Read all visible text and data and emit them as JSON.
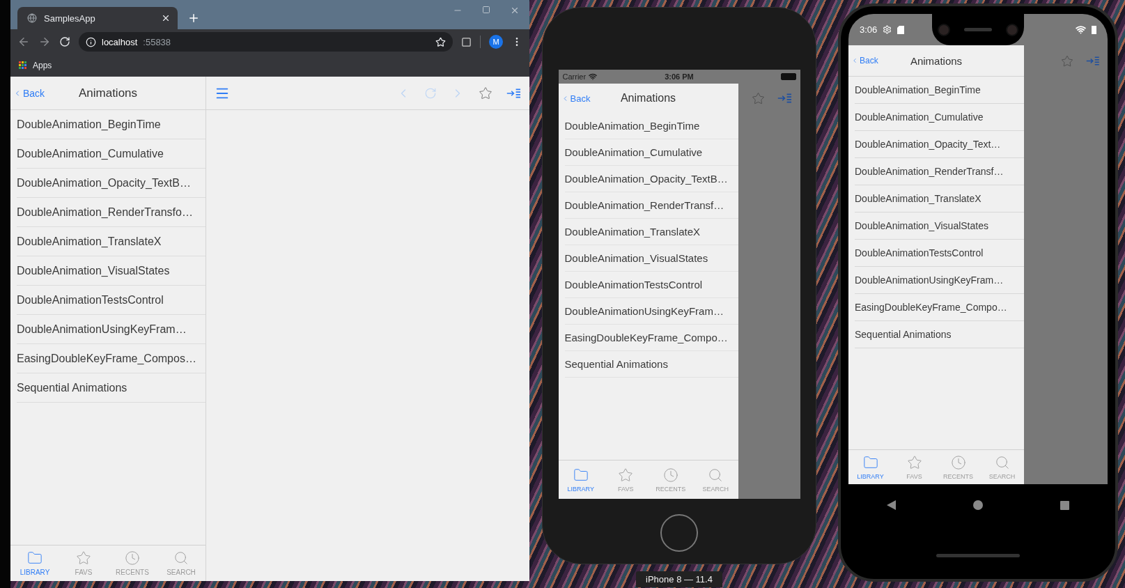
{
  "browser": {
    "tab_title": "SamplesApp",
    "url_host": "localhost",
    "url_port": ":55838",
    "avatar": "M",
    "bookmark": "Apps",
    "app": {
      "back": "Back",
      "title": "Animations",
      "items": [
        "DoubleAnimation_BeginTime",
        "DoubleAnimation_Cumulative",
        "DoubleAnimation_Opacity_TextB…",
        "DoubleAnimation_RenderTransfo…",
        "DoubleAnimation_TranslateX",
        "DoubleAnimation_VisualStates",
        "DoubleAnimationTestsControl",
        "DoubleAnimationUsingKeyFram…",
        "EasingDoubleKeyFrame_Compos…",
        "Sequential Animations"
      ],
      "tabs": [
        {
          "label": "LIBRARY",
          "selected": true
        },
        {
          "label": "FAVS",
          "selected": false
        },
        {
          "label": "RECENTS",
          "selected": false
        },
        {
          "label": "SEARCH",
          "selected": false
        }
      ]
    }
  },
  "iphone": {
    "carrier": "Carrier",
    "time": "3:06 PM",
    "device_label": "iPhone 8 — 11.4",
    "app": {
      "back": "Back",
      "title": "Animations",
      "items": [
        "DoubleAnimation_BeginTime",
        "DoubleAnimation_Cumulative",
        "DoubleAnimation_Opacity_TextB…",
        "DoubleAnimation_RenderTransf…",
        "DoubleAnimation_TranslateX",
        "DoubleAnimation_VisualStates",
        "DoubleAnimationTestsControl",
        "DoubleAnimationUsingKeyFram…",
        "EasingDoubleKeyFrame_Compo…",
        "Sequential Animations"
      ],
      "tabs": [
        {
          "label": "LIBRARY",
          "selected": true
        },
        {
          "label": "FAVS",
          "selected": false
        },
        {
          "label": "RECENTS",
          "selected": false
        },
        {
          "label": "SEARCH",
          "selected": false
        }
      ]
    }
  },
  "android": {
    "time": "3:06",
    "app": {
      "back": "Back",
      "title": "Animations",
      "items": [
        "DoubleAnimation_BeginTime",
        "DoubleAnimation_Cumulative",
        "DoubleAnimation_Opacity_Text…",
        "DoubleAnimation_RenderTransf…",
        "DoubleAnimation_TranslateX",
        "DoubleAnimation_VisualStates",
        "DoubleAnimationTestsControl",
        "DoubleAnimationUsingKeyFram…",
        "EasingDoubleKeyFrame_Compo…",
        "Sequential Animations"
      ],
      "tabs": [
        {
          "label": "LIBRARY",
          "selected": true
        },
        {
          "label": "FAVS",
          "selected": false
        },
        {
          "label": "RECENTS",
          "selected": false
        },
        {
          "label": "SEARCH",
          "selected": false
        }
      ]
    }
  }
}
